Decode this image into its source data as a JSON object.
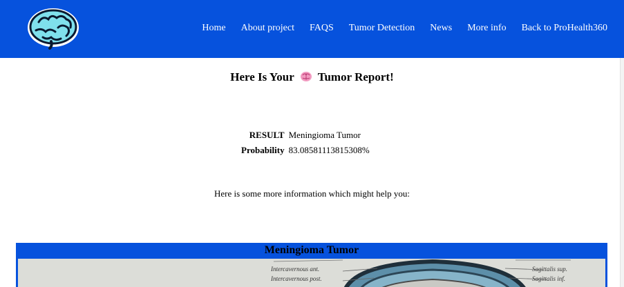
{
  "navbar": {
    "logo_icon": "brain-logo-icon",
    "links": [
      "Home",
      "About project",
      "FAQS",
      "Tumor Detection",
      "News",
      "More info",
      "Back to ProHealth360"
    ],
    "color": "#0652dd"
  },
  "report": {
    "title_before": "Here Is Your",
    "title_icon": "brain-emoji-icon",
    "title_after": "Tumor Report!",
    "result_label": "RESULT",
    "result_value": "Meningioma Tumor",
    "probability_label": "Probability",
    "probability_value": "83.08581113815308%"
  },
  "info_text": "Here is some more information which might help you:",
  "tumor_card": {
    "title": "Meningioma Tumor",
    "image_labels": {
      "left_1": "Intercavernous ant.",
      "left_2": "Intercavernous post.",
      "right_1": "Sagittalis sup.",
      "right_2": "Sagittalis inf."
    }
  }
}
